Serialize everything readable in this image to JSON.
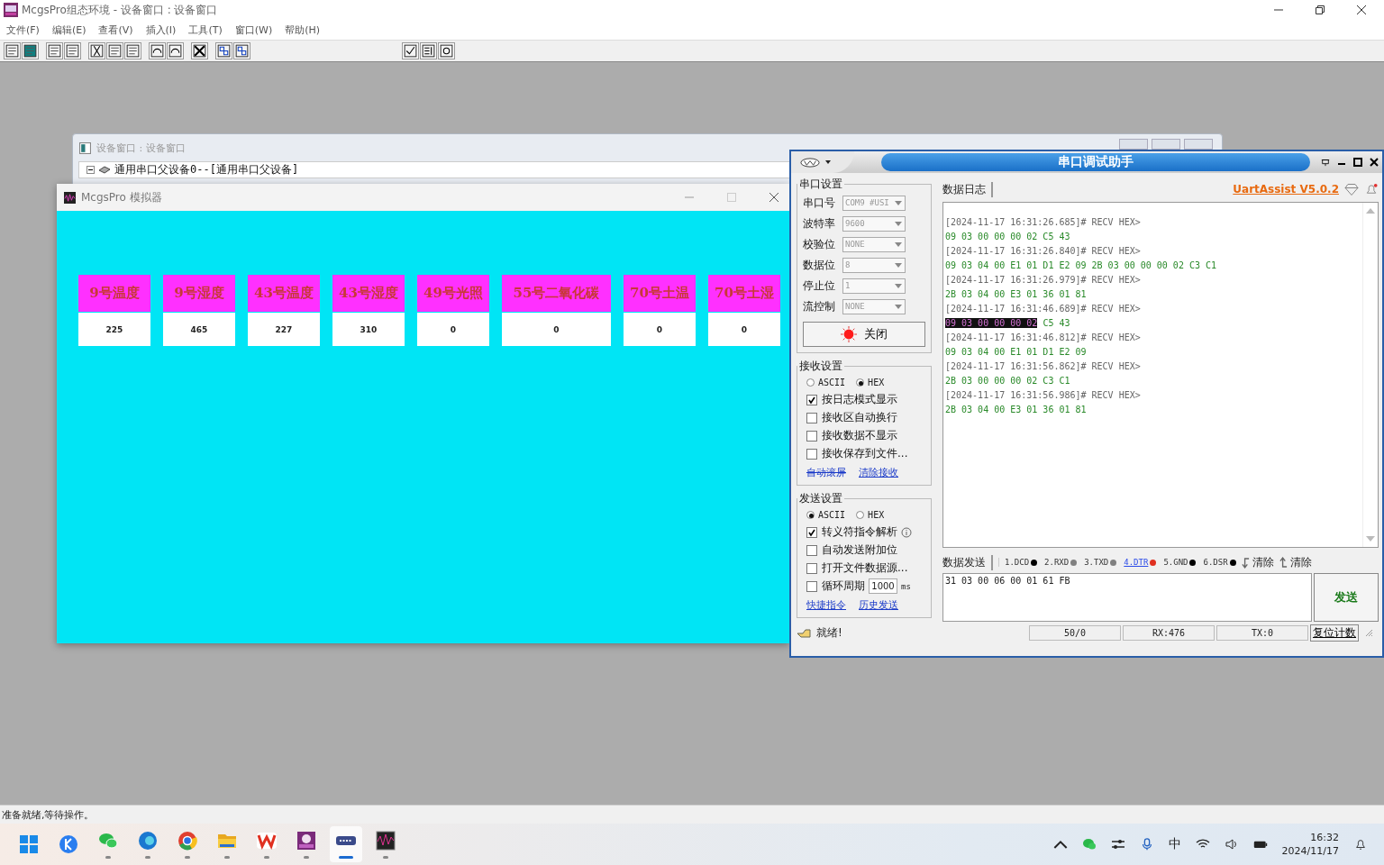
{
  "main_window": {
    "title": "McgsPro组态环境 - 设备窗口 : 设备窗口",
    "menu": [
      "文件(F)",
      "编辑(E)",
      "查看(V)",
      "插入(I)",
      "工具(T)",
      "窗口(W)",
      "帮助(H)"
    ],
    "status": "准备就绪,等待操作。"
  },
  "device_window": {
    "title": "设备窗口 : 设备窗口",
    "tree": [
      {
        "label": "通用串口父设备0--[通用串口父设备]",
        "expanded": true
      }
    ]
  },
  "simulator": {
    "title": "McgsPro 模拟器",
    "tiles": [
      {
        "label": "9号温度",
        "value": "225",
        "wide": false
      },
      {
        "label": "9号湿度",
        "value": "465",
        "wide": false
      },
      {
        "label": "43号温度",
        "value": "227",
        "wide": false
      },
      {
        "label": "43号湿度",
        "value": "310",
        "wide": false
      },
      {
        "label": "49号光照",
        "value": "0",
        "wide": false
      },
      {
        "label": "55号二氧化碳",
        "value": "0",
        "wide": true
      },
      {
        "label": "70号土温",
        "value": "0",
        "wide": false
      },
      {
        "label": "70号土湿",
        "value": "0",
        "wide": false
      }
    ]
  },
  "uart": {
    "title": "串口调试助手",
    "port_settings": {
      "title": "串口设置",
      "fields": [
        {
          "label": "串口号",
          "value": "COM9 #USI"
        },
        {
          "label": "波特率",
          "value": "9600"
        },
        {
          "label": "校验位",
          "value": "NONE"
        },
        {
          "label": "数据位",
          "value": "8"
        },
        {
          "label": "停止位",
          "value": "1"
        },
        {
          "label": "流控制",
          "value": "NONE"
        }
      ],
      "button": "关闭",
      "open": true
    },
    "receive_settings": {
      "title": "接收设置",
      "modes": [
        {
          "label": "ASCII",
          "selected": false
        },
        {
          "label": "HEX",
          "selected": true
        }
      ],
      "options": [
        {
          "label": "按日志模式显示",
          "checked": true
        },
        {
          "label": "接收区自动换行",
          "checked": false
        },
        {
          "label": "接收数据不显示",
          "checked": false
        },
        {
          "label": "接收保存到文件...",
          "checked": false
        }
      ],
      "links": [
        {
          "label": "自动滚屏",
          "disabled": true
        },
        {
          "label": "清除接收",
          "disabled": false
        }
      ]
    },
    "send_settings": {
      "title": "发送设置",
      "modes": [
        {
          "label": "ASCII",
          "selected": true
        },
        {
          "label": "HEX",
          "selected": false
        }
      ],
      "options": [
        {
          "label": "转义符指令解析",
          "checked": true,
          "kind": "info"
        },
        {
          "label": "自动发送附加位",
          "checked": false,
          "kind": "plain"
        },
        {
          "label": "打开文件数据源...",
          "checked": false,
          "kind": "plain"
        },
        {
          "label": "循环周期",
          "checked": false,
          "kind": "period",
          "value": "1000",
          "unit": "ms"
        }
      ],
      "links": [
        {
          "label": "快捷指令",
          "disabled": false
        },
        {
          "label": "历史发送",
          "disabled": false
        }
      ]
    },
    "status": "就绪!",
    "log_tab": "数据日志",
    "version": "UartAssist V5.0.2",
    "log": [
      {
        "kind": "header",
        "text": "[2024-11-17 16:31:26.685]# RECV HEX>"
      },
      {
        "kind": "data",
        "text": "09 03 00 00 00 02 C5 43"
      },
      {
        "kind": "header",
        "text": "[2024-11-17 16:31:26.840]# RECV HEX>"
      },
      {
        "kind": "data",
        "text": "09 03 04 00 E1 01 D1 E2 09 2B 03 00 00 00 02 C3 C1"
      },
      {
        "kind": "header",
        "text": "[2024-11-17 16:31:26.979]# RECV HEX>"
      },
      {
        "kind": "data",
        "text": "2B 03 04 00 E3 01 36 01 81"
      },
      {
        "kind": "header",
        "text": "[2024-11-17 16:31:46.689]# RECV HEX>"
      },
      {
        "kind": "data",
        "selection": "09 03 00 00 00 02",
        "text": " C5 43"
      },
      {
        "kind": "header",
        "text": "[2024-11-17 16:31:46.812]# RECV HEX>"
      },
      {
        "kind": "data",
        "text": "09 03 04 00 E1 01 D1 E2 09"
      },
      {
        "kind": "header",
        "text": "[2024-11-17 16:31:56.862]# RECV HEX>"
      },
      {
        "kind": "data",
        "text": "2B 03 00 00 00 02 C3 C1"
      },
      {
        "kind": "header",
        "text": "[2024-11-17 16:31:56.986]# RECV HEX>"
      },
      {
        "kind": "data",
        "text": "2B 03 04 00 E3 01 36 01 81"
      }
    ],
    "send_tab": "数据发送",
    "pins": [
      {
        "label": "1.DCD",
        "color": "#000000",
        "link": false
      },
      {
        "label": "2.RXD",
        "color": "#808080",
        "link": false
      },
      {
        "label": "3.TXD",
        "color": "#808080",
        "link": false
      },
      {
        "label": "4.DTR",
        "color": "#e03020",
        "link": true
      },
      {
        "label": "5.GND",
        "color": "#000000",
        "link": false
      },
      {
        "label": "6.DSR",
        "color": "#000000",
        "link": false
      }
    ],
    "clear_buttons": [
      "清除",
      "清除"
    ],
    "send_text": "31 03 00 06 00 01 61 FB",
    "send_button": "发送",
    "counters": [
      "50/0",
      "RX:476",
      "TX:0"
    ],
    "reset_button": "复位计数"
  },
  "taskbar": {
    "apps": [
      {
        "kind": "start",
        "running": false,
        "selected": false
      },
      {
        "kind": "k",
        "running": false,
        "selected": false
      },
      {
        "kind": "chat",
        "running": true,
        "selected": false
      },
      {
        "kind": "edge",
        "running": true,
        "selected": false
      },
      {
        "kind": "chrome",
        "running": true,
        "selected": false
      },
      {
        "kind": "folder",
        "running": true,
        "selected": false
      },
      {
        "kind": "wps",
        "running": true,
        "selected": false
      },
      {
        "kind": "mcgs",
        "running": true,
        "selected": false
      },
      {
        "kind": "serial",
        "running": true,
        "selected": true
      },
      {
        "kind": "wave",
        "running": true,
        "selected": false
      }
    ],
    "ime": "中",
    "time": "16:32",
    "date": "2024/11/17"
  }
}
